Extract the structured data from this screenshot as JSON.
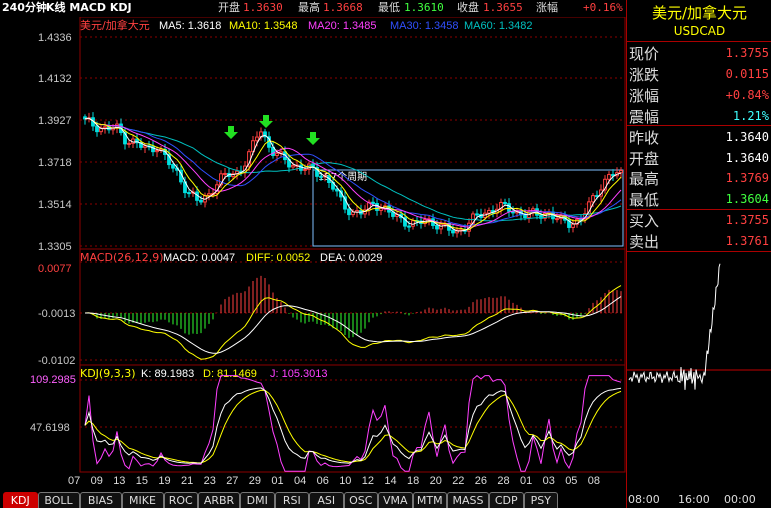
{
  "title_bar": {
    "period": "240分钟",
    "indicators": "K线 MACD KDJ",
    "open_label": "开盘",
    "open": "1.3630",
    "high_label": "最高",
    "high": "1.3668",
    "low_label": "最低",
    "low": "1.3610",
    "close_label": "收盘",
    "close": "1.3655",
    "change_label": "涨幅",
    "change": "+0.16%"
  },
  "main_chart": {
    "symbol_cn": "美元/加拿大元",
    "ma5": "MA5: 1.3618",
    "ma10": "MA10: 1.3548",
    "ma20": "MA20: 1.3485",
    "ma30": "MA30: 1.3458",
    "ma60": "MA60: 1.3482",
    "box_label": "157个周期",
    "colors": {
      "ma5": "#ffffff",
      "ma10": "#ffff00",
      "ma20": "#ff00ff",
      "ma30": "#3050ff",
      "ma60": "#00c0c0",
      "up": "#ff4040",
      "down": "#00e0e0",
      "grid": "#8b0000",
      "arrow": "#22e022"
    }
  },
  "macd_panel": {
    "header": "MACD(26,12,9)",
    "macd": "MACD: 0.0047",
    "diff": "DIFF: 0.0052",
    "dea": "DEA: 0.0029"
  },
  "kdj_panel": {
    "header": "KDJ(9,3,3)",
    "k": "K: 89.1983",
    "d": "D: 81.1469",
    "j": "J: 105.3013"
  },
  "x_axis": [
    "07",
    "09",
    "13",
    "15",
    "19",
    "21",
    "23",
    "27",
    "29",
    "01",
    "04",
    "06",
    "10",
    "12",
    "14",
    "18",
    "20",
    "22",
    "26",
    "28",
    "01",
    "03",
    "05",
    "08"
  ],
  "tabs": [
    "KDJ",
    "BOLL",
    "BIAS",
    "MIKE",
    "ROC",
    "ARBR",
    "DMI",
    "RSI",
    "ASI",
    "OSC",
    "VMA",
    "MTM",
    "MASS",
    "CDP",
    "PSY"
  ],
  "active_tab": "KDJ",
  "quote_panel": {
    "name_cn": "美元/加拿大元",
    "code": "USDCAD",
    "rows": [
      {
        "label": "现价",
        "value": "1.3755",
        "color": "#ff4040"
      },
      {
        "label": "涨跌",
        "value": "0.0115",
        "color": "#ff4040"
      },
      {
        "label": "涨幅",
        "value": "+0.84%",
        "color": "#ff4040"
      },
      {
        "label": "震幅",
        "value": "1.21%",
        "color": "#40ffff"
      },
      {
        "label": "昨收",
        "value": "1.3640",
        "color": "#ffffff"
      },
      {
        "label": "开盘",
        "value": "1.3640",
        "color": "#ffffff"
      },
      {
        "label": "最高",
        "value": "1.3769",
        "color": "#ff4040"
      },
      {
        "label": "最低",
        "value": "1.3604",
        "color": "#40ff40"
      },
      {
        "label": "买入",
        "value": "1.3755",
        "color": "#ff4040"
      },
      {
        "label": "卖出",
        "value": "1.3761",
        "color": "#ff4040"
      }
    ],
    "time_axis": [
      "08:00",
      "16:00",
      "00:00"
    ]
  },
  "chart_data": [
    {
      "type": "candlestick",
      "title": "美元/加拿大元",
      "y_ticks": [
        "1.4336",
        "1.4132",
        "1.3927",
        "1.3718",
        "1.3514",
        "1.3305"
      ],
      "ylim": [
        1.3305,
        1.4336
      ],
      "close_approx": [
        1.392,
        1.39,
        1.388,
        1.389,
        1.383,
        1.381,
        1.378,
        1.38,
        1.372,
        1.366,
        1.357,
        1.352,
        1.356,
        1.363,
        1.366,
        1.367,
        1.376,
        1.389,
        1.378,
        1.374,
        1.371,
        1.369,
        1.368,
        1.366,
        1.36,
        1.351,
        1.347,
        1.347,
        1.352,
        1.349,
        1.345,
        1.343,
        1.341,
        1.343,
        1.342,
        1.339,
        1.337,
        1.341,
        1.345,
        1.347,
        1.35,
        1.349,
        1.347,
        1.346,
        1.346,
        1.347,
        1.343,
        1.342,
        1.343,
        1.351,
        1.36,
        1.366,
        1.3655
      ]
    },
    {
      "type": "bar",
      "title": "MACD(26,12,9)",
      "y_ticks": [
        "0.0077",
        "-0.0013",
        "-0.0102"
      ],
      "ylim": [
        -0.0102,
        0.0077
      ]
    },
    {
      "type": "line",
      "title": "KDJ(9,3,3)",
      "y_ticks": [
        "109.2985",
        "47.6198"
      ],
      "series": [
        {
          "name": "K"
        },
        {
          "name": "D"
        },
        {
          "name": "J"
        }
      ]
    },
    {
      "type": "line",
      "title": "USDCAD",
      "x_ticks": [
        "08:00",
        "16:00",
        "00:00"
      ]
    }
  ]
}
